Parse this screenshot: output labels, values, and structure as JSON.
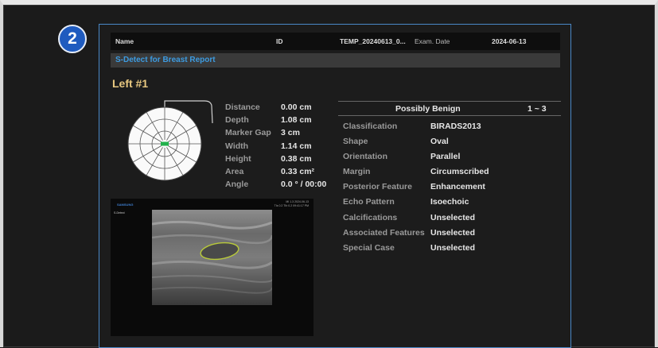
{
  "step": {
    "number": "2"
  },
  "patient": {
    "name_label": "Name",
    "id_label": "ID",
    "id_value": "TEMP_20240613_0...",
    "exam_date_label": "Exam. Date",
    "exam_date_value": "2024-06-13"
  },
  "report_title": "S-Detect for Breast Report",
  "lesion_title": "Left #1",
  "measurements": [
    {
      "label": "Distance",
      "value": "0.00 cm"
    },
    {
      "label": "Depth",
      "value": "1.08 cm"
    },
    {
      "label": "Marker Gap",
      "value": "3 cm"
    },
    {
      "label": "Width",
      "value": "1.14 cm"
    },
    {
      "label": "Height",
      "value": "0.38 cm"
    },
    {
      "label": "Area",
      "value": "0.33 cm²"
    },
    {
      "label": "Angle",
      "value": "0.0 ° / 00:00"
    }
  ],
  "result": {
    "assessment": "Possibly Benign",
    "range": "1 ~ 3"
  },
  "classification": [
    {
      "label": "Classification",
      "value": "BIRADS2013"
    },
    {
      "label": "Shape",
      "value": "Oval"
    },
    {
      "label": "Orientation",
      "value": "Parallel"
    },
    {
      "label": "Margin",
      "value": "Circumscribed"
    },
    {
      "label": "Posterior Feature",
      "value": "Enhancement"
    },
    {
      "label": "Echo Pattern",
      "value": "Isoechoic"
    },
    {
      "label": "Calcifications",
      "value": "Unselected"
    },
    {
      "label": "Associated Features",
      "value": "Unselected"
    },
    {
      "label": "Special Case",
      "value": "Unselected"
    }
  ],
  "ultrasound": {
    "brand": "SAMSUNG",
    "mode": "S-Detect",
    "info_line1": "MI 1.3     2024-06-13",
    "info_line2": "TIs 0.2   TIb 0.2   09:41:17 PM"
  },
  "colors": {
    "panel_border": "#4a88c8",
    "title_text": "#3d9be0",
    "lesion_title": "#e8c880",
    "badge": "#1f5bbf",
    "marker": "#22b14c",
    "lesion_outline": "#b8c93a"
  },
  "icons": {
    "step_badge": "circled-number-two-icon",
    "breast_clock": "breast-clock-diagram-icon"
  }
}
